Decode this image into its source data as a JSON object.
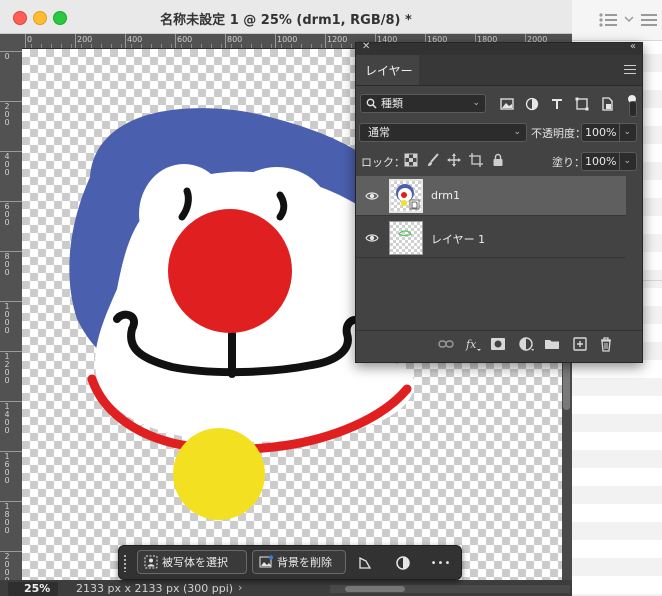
{
  "document": {
    "title": "名称未設定 1 @ 25% (drm1, RGB/8) *",
    "zoom": "25%",
    "info": "2133 px x 2133 px (300 ppi)",
    "info_arrow": "›",
    "ruler_top": [
      "0",
      "200",
      "400",
      "600",
      "800",
      "1000",
      "1200",
      "1400",
      "1600",
      "1800",
      "2000"
    ],
    "ruler_left": [
      "0",
      "200",
      "400",
      "600",
      "800",
      "1000",
      "1200",
      "1400",
      "1600",
      "1800",
      "2000"
    ]
  },
  "taskbar": {
    "select_subject": "被写体を選択",
    "remove_background": "背景を削除",
    "more": "•••"
  },
  "layers_panel": {
    "tab": "レイヤー",
    "filter_kind": "種類",
    "blend_mode": "通常",
    "opacity_label": "不透明度：",
    "opacity_value": "100%",
    "lock_label": "ロック：",
    "fill_label": "塗り：",
    "fill_value": "100%",
    "layers": [
      {
        "name": "drm1",
        "visible": true,
        "selected": true
      },
      {
        "name": "レイヤー 1",
        "visible": true,
        "selected": false
      }
    ]
  },
  "colors": {
    "blue": "#4a5fae",
    "red": "#e02020",
    "yellow": "#f2e021",
    "black": "#111111",
    "panel": "#434343"
  }
}
